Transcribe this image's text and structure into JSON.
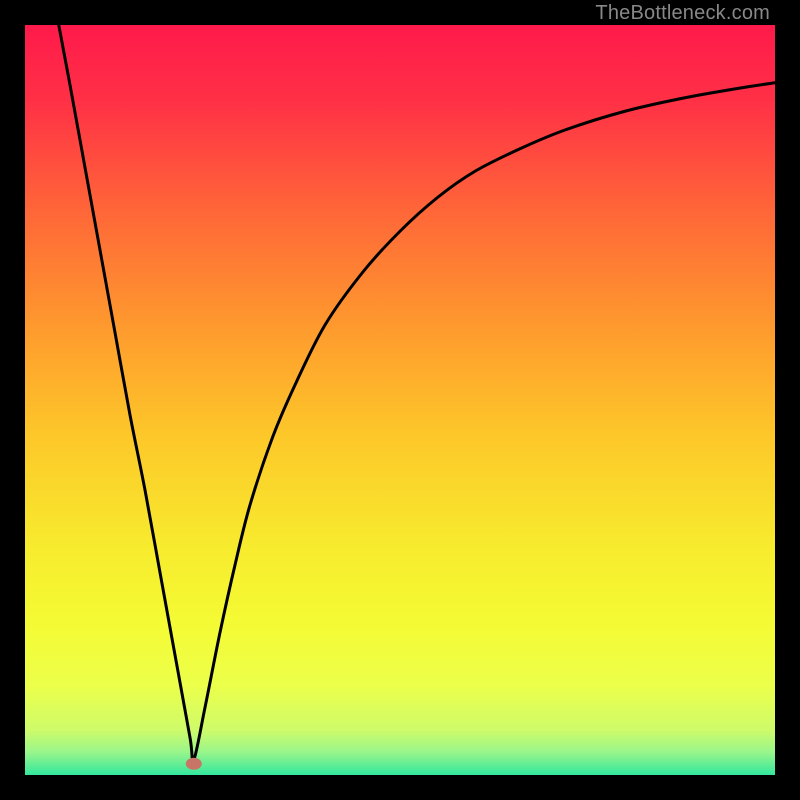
{
  "watermark": "TheBottleneck.com",
  "chart_data": {
    "type": "line",
    "title": "",
    "xlabel": "",
    "ylabel": "",
    "xlim": [
      0,
      100
    ],
    "ylim": [
      0,
      100
    ],
    "grid": false,
    "legend": false,
    "background_gradient": {
      "stops": [
        {
          "offset": 0.0,
          "color": "#ff1a4b"
        },
        {
          "offset": 0.1,
          "color": "#ff3046"
        },
        {
          "offset": 0.25,
          "color": "#ff6738"
        },
        {
          "offset": 0.4,
          "color": "#fe992e"
        },
        {
          "offset": 0.55,
          "color": "#fdc829"
        },
        {
          "offset": 0.7,
          "color": "#f7ec2e"
        },
        {
          "offset": 0.8,
          "color": "#f4fb34"
        },
        {
          "offset": 0.88,
          "color": "#ecff4a"
        },
        {
          "offset": 0.94,
          "color": "#cefb6a"
        },
        {
          "offset": 0.97,
          "color": "#98f58b"
        },
        {
          "offset": 1.0,
          "color": "#33e79e"
        }
      ]
    },
    "marker": {
      "x": 22.5,
      "y": 1.5,
      "color": "#c87568"
    },
    "series": [
      {
        "name": "curve",
        "x": [
          4.5,
          6,
          8,
          10,
          12,
          14,
          16,
          18,
          20,
          22,
          22.5,
          24,
          26,
          28,
          30,
          33,
          36,
          40,
          45,
          50,
          55,
          60,
          66,
          72,
          80,
          88,
          96,
          100
        ],
        "y": [
          100,
          92,
          81,
          70,
          59,
          48,
          38,
          27,
          16,
          5,
          2,
          9,
          19,
          28,
          36,
          45,
          52,
          60,
          67,
          72.5,
          77,
          80.5,
          83.5,
          86,
          88.5,
          90.3,
          91.7,
          92.3
        ]
      }
    ]
  }
}
